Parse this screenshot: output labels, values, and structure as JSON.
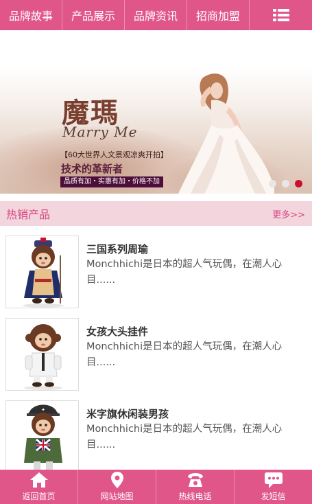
{
  "nav": {
    "items": [
      {
        "label": "品牌故事"
      },
      {
        "label": "产品展示"
      },
      {
        "label": "品牌资讯"
      },
      {
        "label": "招商加盟"
      }
    ],
    "menu_icon": "list-menu-icon"
  },
  "banner": {
    "brand_cn": "魔瑪",
    "brand_en": "Marry Me",
    "tagline": "【60大世界人文景观凉爽开拍】",
    "slogan": "技术的革新者",
    "feature": "品质有加・实惠有加・价格不加",
    "slide_count": 3,
    "active_slide": 3
  },
  "section": {
    "title": "热销产品",
    "more": "更多>>"
  },
  "products": [
    {
      "name": "三国系列周瑜",
      "desc": "Monchhichi是日本的超人气玩偶，在潮人心目......"
    },
    {
      "name": "女孩大头挂件",
      "desc": "Monchhichi是日本的超人气玩偶，在潮人心目......"
    },
    {
      "name": "米字旗休闲装男孩",
      "desc": "Monchhichi是日本的超人气玩偶，在潮人心目......"
    }
  ],
  "bottom": {
    "tabs": [
      {
        "label": "返回首页",
        "icon": "home-icon"
      },
      {
        "label": "网站地图",
        "icon": "map-pin-icon"
      },
      {
        "label": "热线电话",
        "icon": "phone-icon"
      },
      {
        "label": "发短信",
        "icon": "message-icon"
      }
    ]
  },
  "colors": {
    "accent": "#e05689",
    "section_bg": "#f3d5de",
    "section_text": "#d9457f",
    "active_dot": "#c8102e"
  }
}
